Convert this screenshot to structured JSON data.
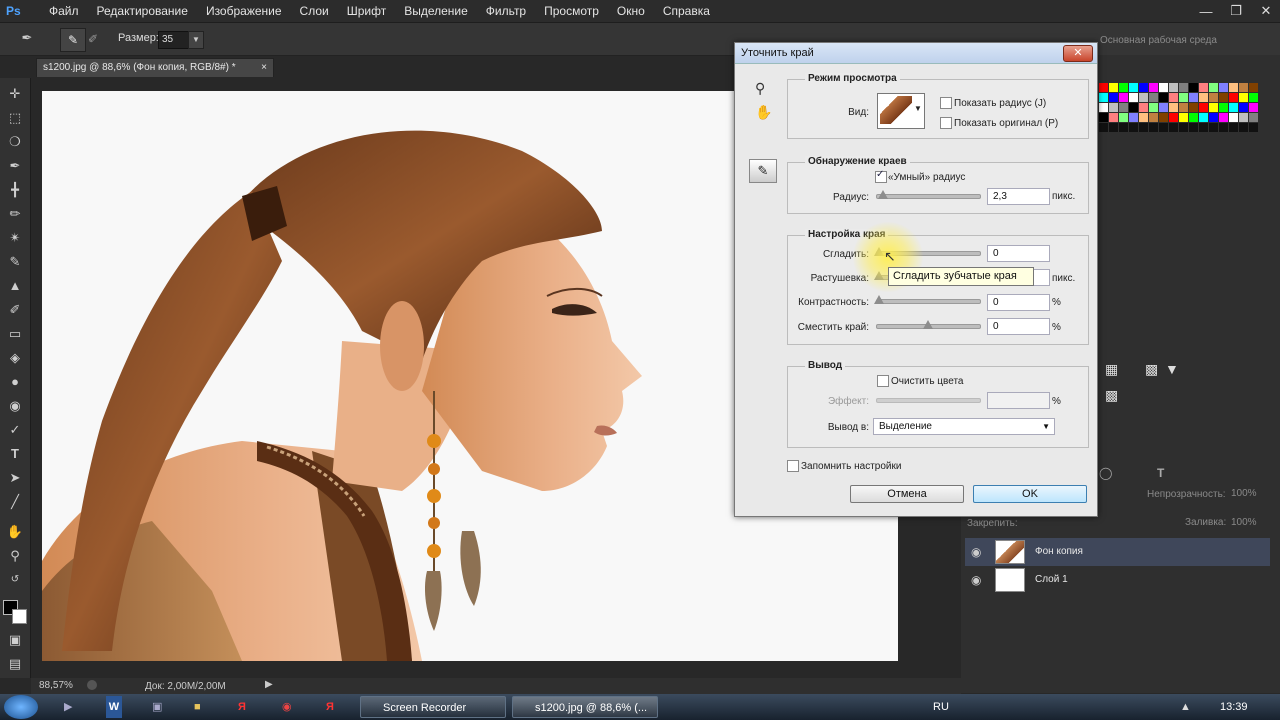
{
  "app": {
    "logo": "Ps",
    "menu": [
      "Файл",
      "Редактирование",
      "Изображение",
      "Слои",
      "Шрифт",
      "Выделение",
      "Фильтр",
      "Просмотр",
      "Окно",
      "Справка"
    ],
    "window_controls": [
      "minimize-icon",
      "restore-icon",
      "close-icon"
    ]
  },
  "options_bar": {
    "size_label": "Размер:",
    "size_value": "35",
    "workspace": "Основная рабочая среда"
  },
  "document": {
    "tab_title": "s1200.jpg @ 88,6% (Фон копия, RGB/8#) *",
    "tab_close": "×",
    "zoom": "88,57%",
    "doc_info": "Док: 2,00M/2,00M"
  },
  "dialog": {
    "title": "Уточнить край",
    "close": "✕",
    "view_mode": {
      "title": "Режим просмотра",
      "view_label": "Вид:",
      "show_radius": "Показать радиус (J)",
      "show_radius_checked": false,
      "show_original": "Показать оригинал (P)",
      "show_original_checked": false
    },
    "edge_detection": {
      "title": "Обнаружение краев",
      "smart_radius": "«Умный» радиус",
      "smart_radius_checked": true,
      "radius_label": "Радиус:",
      "radius_value": "2,3",
      "radius_unit": "пикс.",
      "radius_level": 0.04
    },
    "adjust_edge": {
      "title": "Настройка края",
      "smooth_label": "Сгладить:",
      "smooth_value": "0",
      "smooth_level": 0,
      "feather_label": "Растушевка:",
      "feather_value": "",
      "feather_unit": "пикс.",
      "feather_level": 0,
      "contrast_label": "Контрастность:",
      "contrast_value": "0",
      "contrast_unit": "%",
      "contrast_level": 0,
      "shift_label": "Сместить край:",
      "shift_value": "0",
      "shift_unit": "%",
      "shift_level": 0.5
    },
    "output": {
      "title": "Вывод",
      "decontaminate": "Очистить цвета",
      "decontaminate_checked": false,
      "amount_label": "Эффект:",
      "amount_unit": "%",
      "output_to_label": "Вывод в:",
      "output_to_value": "Выделение"
    },
    "remember": "Запомнить настройки",
    "remember_checked": false,
    "cancel": "Отмена",
    "ok": "OK",
    "tooltip": "Сгладить зубчатые края"
  },
  "layers_panel": {
    "opacity_label": "Непрозрачность:",
    "opacity_value": "100%",
    "lock_label": "Закрепить:",
    "fill_label": "Заливка:",
    "fill_value": "100%",
    "layers": [
      {
        "name": "Фон копия",
        "selected": true
      },
      {
        "name": "Слой 1",
        "selected": false
      }
    ]
  },
  "taskbar": {
    "items": [
      {
        "label": "Screen Recorder"
      },
      {
        "label": "s1200.jpg @ 88,6% (..."
      }
    ],
    "lang": "RU",
    "time": "13:39"
  },
  "colors": {
    "ps_bg": "#282828",
    "accent_blue": "#3c7fb1",
    "tooltip_bg": "#ffffe1",
    "highlight": "#ffee50"
  }
}
